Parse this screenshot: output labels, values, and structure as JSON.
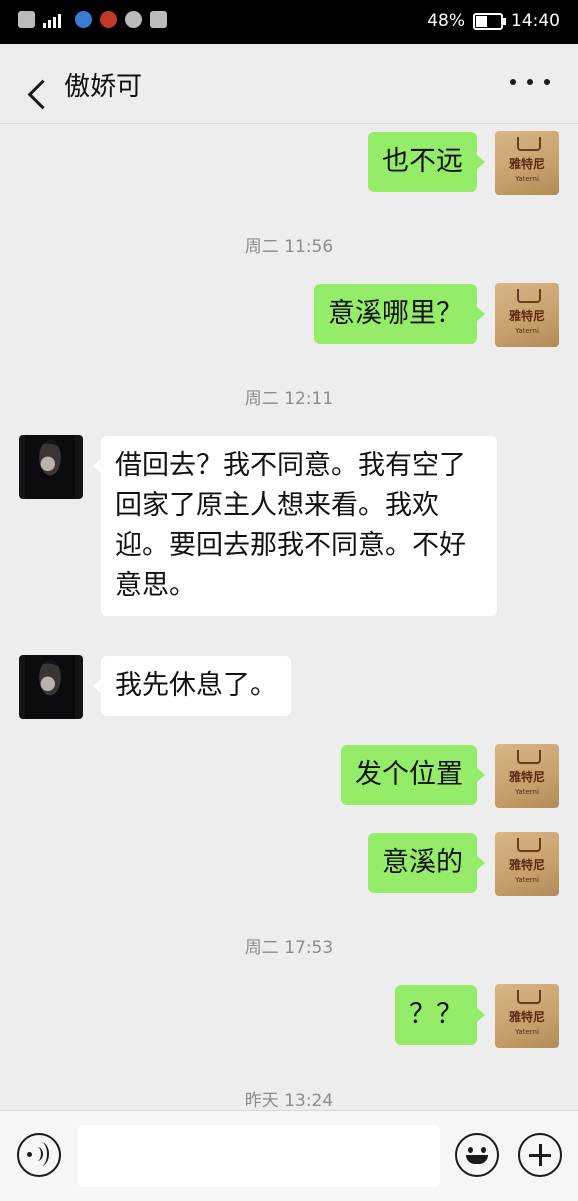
{
  "status_bar": {
    "battery": "48%",
    "time": "14:40",
    "network": "4G"
  },
  "header": {
    "title": "傲娇可"
  },
  "messages": [
    {
      "type": "outgoing",
      "text": "也不远"
    },
    {
      "type": "time",
      "text": "周二 11:56"
    },
    {
      "type": "outgoing",
      "text": "意溪哪里？"
    },
    {
      "type": "time",
      "text": "周二 12:11"
    },
    {
      "type": "incoming",
      "text": "借回去？我不同意。我有空了回家了原主人想来看。我欢迎。要回去那我不同意。不好意思。"
    },
    {
      "type": "incoming",
      "text": "我先休息了。"
    },
    {
      "type": "outgoing",
      "text": "发个位置"
    },
    {
      "type": "outgoing",
      "text": "意溪的"
    },
    {
      "type": "time",
      "text": "周二 17:53"
    },
    {
      "type": "outgoing",
      "text": "？？"
    },
    {
      "type": "time",
      "text": "昨天 13:24"
    }
  ],
  "my_avatar": {
    "logo_text": "雅特尼",
    "script_text": "Yaterni shir",
    "small_text": "Yaterni"
  },
  "input_bar": {
    "value": ""
  },
  "icons": {
    "back": "chevron-left-icon",
    "more": "more-dots-icon",
    "voice": "voice-icon",
    "emoji": "emoji-icon",
    "add": "plus-icon"
  }
}
